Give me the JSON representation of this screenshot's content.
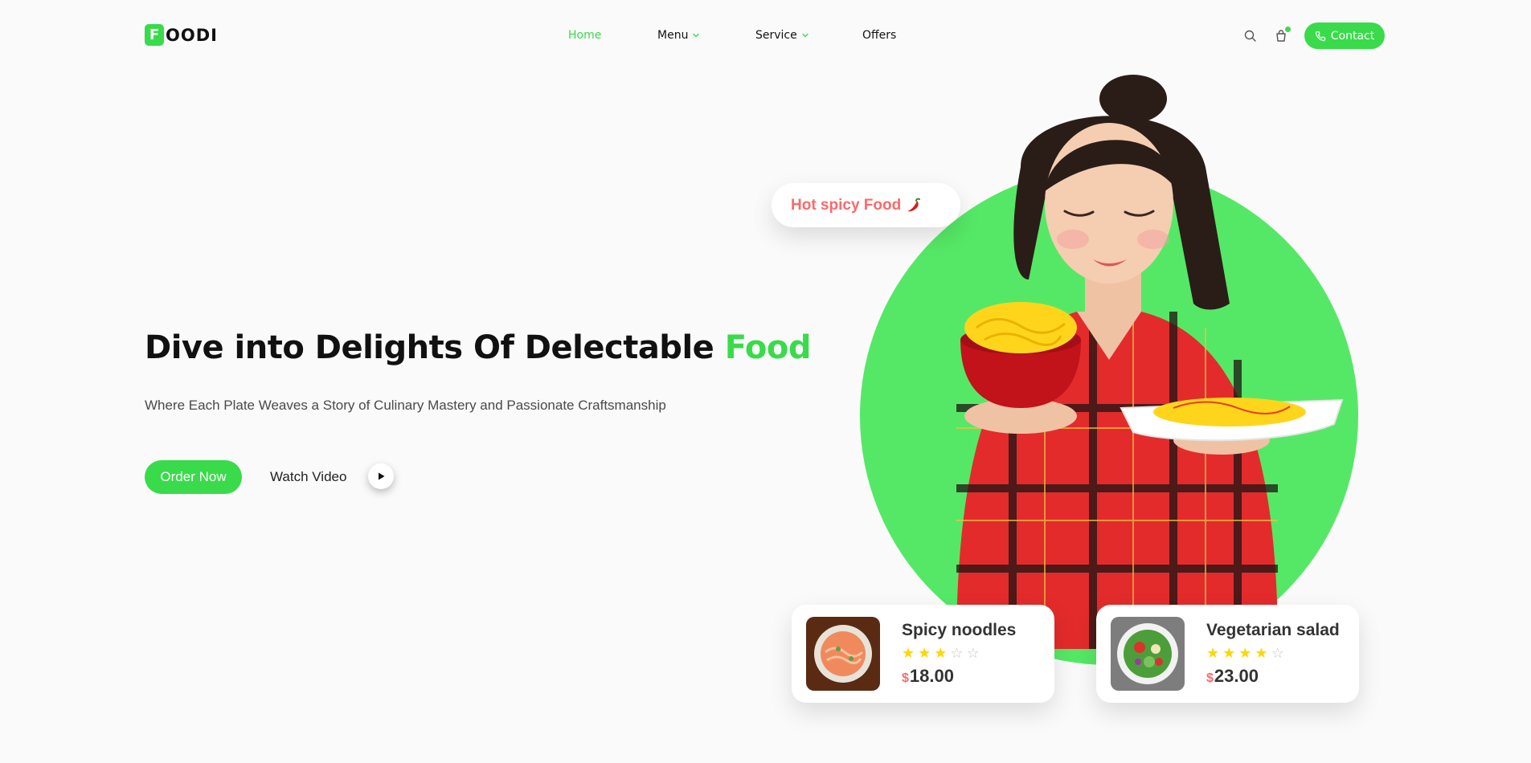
{
  "brand": {
    "badge": "F",
    "name": "OODI",
    "accent_color": "#39db4a"
  },
  "nav": {
    "items": [
      {
        "label": "Home",
        "active": true,
        "dropdown": false
      },
      {
        "label": "Menu",
        "active": false,
        "dropdown": true
      },
      {
        "label": "Service",
        "active": false,
        "dropdown": true
      },
      {
        "label": "Offers",
        "active": false,
        "dropdown": false
      }
    ],
    "icons": [
      "search-icon",
      "cart-icon"
    ],
    "contact_label": "Contact",
    "contact_icon": "phone-icon"
  },
  "hero": {
    "title_main": "Dive into Delights Of Delectable ",
    "title_accent": "Food",
    "subtitle": "Where Each Plate Weaves a Story of Culinary Mastery and Passionate Craftsmanship",
    "order_label": "Order Now",
    "watch_label": "Watch Video",
    "bubble_text": "Hot spicy Food"
  },
  "cards": [
    {
      "name": "Spicy noodles",
      "rating": 3,
      "max_rating": 5,
      "currency": "$",
      "price": "18.00"
    },
    {
      "name": "Vegetarian salad",
      "rating": 4,
      "max_rating": 5,
      "currency": "$",
      "price": "23.00"
    }
  ],
  "colors": {
    "green": "#39db4a",
    "circle": "#55e866",
    "price_symbol": "#ff6868",
    "bubble_text": "#ff6868",
    "star": "#ffd600"
  }
}
